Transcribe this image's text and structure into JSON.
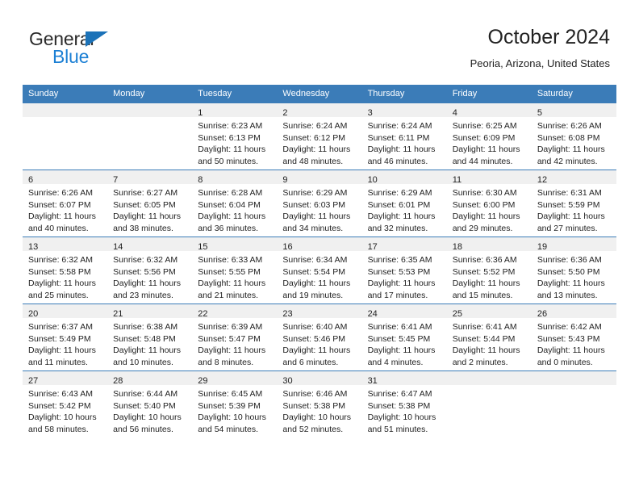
{
  "brand": {
    "name_top": "General",
    "name_bottom": "Blue",
    "accent_dark": "#1b72b8",
    "accent_light": "#1b7fd4"
  },
  "header": {
    "title": "October 2024",
    "subtitle": "Peoria, Arizona, United States"
  },
  "theme": {
    "header_bar": "#3b7cb8",
    "daynum_band": "#f0f0f0",
    "grid_line": "#3b7cb8",
    "text": "#1f1f1f"
  },
  "weekday_headers": [
    "Sunday",
    "Monday",
    "Tuesday",
    "Wednesday",
    "Thursday",
    "Friday",
    "Saturday"
  ],
  "labels": {
    "sunrise_prefix": "Sunrise:",
    "sunset_prefix": "Sunset:",
    "daylight_prefix": "Daylight:"
  },
  "weeks": [
    [
      {
        "day": "",
        "sunrise": "",
        "sunset": "",
        "daylight_line1": "",
        "daylight_line2": ""
      },
      {
        "day": "",
        "sunrise": "",
        "sunset": "",
        "daylight_line1": "",
        "daylight_line2": ""
      },
      {
        "day": "1",
        "sunrise": "Sunrise: 6:23 AM",
        "sunset": "Sunset: 6:13 PM",
        "daylight_line1": "Daylight: 11 hours",
        "daylight_line2": "and 50 minutes."
      },
      {
        "day": "2",
        "sunrise": "Sunrise: 6:24 AM",
        "sunset": "Sunset: 6:12 PM",
        "daylight_line1": "Daylight: 11 hours",
        "daylight_line2": "and 48 minutes."
      },
      {
        "day": "3",
        "sunrise": "Sunrise: 6:24 AM",
        "sunset": "Sunset: 6:11 PM",
        "daylight_line1": "Daylight: 11 hours",
        "daylight_line2": "and 46 minutes."
      },
      {
        "day": "4",
        "sunrise": "Sunrise: 6:25 AM",
        "sunset": "Sunset: 6:09 PM",
        "daylight_line1": "Daylight: 11 hours",
        "daylight_line2": "and 44 minutes."
      },
      {
        "day": "5",
        "sunrise": "Sunrise: 6:26 AM",
        "sunset": "Sunset: 6:08 PM",
        "daylight_line1": "Daylight: 11 hours",
        "daylight_line2": "and 42 minutes."
      }
    ],
    [
      {
        "day": "6",
        "sunrise": "Sunrise: 6:26 AM",
        "sunset": "Sunset: 6:07 PM",
        "daylight_line1": "Daylight: 11 hours",
        "daylight_line2": "and 40 minutes."
      },
      {
        "day": "7",
        "sunrise": "Sunrise: 6:27 AM",
        "sunset": "Sunset: 6:05 PM",
        "daylight_line1": "Daylight: 11 hours",
        "daylight_line2": "and 38 minutes."
      },
      {
        "day": "8",
        "sunrise": "Sunrise: 6:28 AM",
        "sunset": "Sunset: 6:04 PM",
        "daylight_line1": "Daylight: 11 hours",
        "daylight_line2": "and 36 minutes."
      },
      {
        "day": "9",
        "sunrise": "Sunrise: 6:29 AM",
        "sunset": "Sunset: 6:03 PM",
        "daylight_line1": "Daylight: 11 hours",
        "daylight_line2": "and 34 minutes."
      },
      {
        "day": "10",
        "sunrise": "Sunrise: 6:29 AM",
        "sunset": "Sunset: 6:01 PM",
        "daylight_line1": "Daylight: 11 hours",
        "daylight_line2": "and 32 minutes."
      },
      {
        "day": "11",
        "sunrise": "Sunrise: 6:30 AM",
        "sunset": "Sunset: 6:00 PM",
        "daylight_line1": "Daylight: 11 hours",
        "daylight_line2": "and 29 minutes."
      },
      {
        "day": "12",
        "sunrise": "Sunrise: 6:31 AM",
        "sunset": "Sunset: 5:59 PM",
        "daylight_line1": "Daylight: 11 hours",
        "daylight_line2": "and 27 minutes."
      }
    ],
    [
      {
        "day": "13",
        "sunrise": "Sunrise: 6:32 AM",
        "sunset": "Sunset: 5:58 PM",
        "daylight_line1": "Daylight: 11 hours",
        "daylight_line2": "and 25 minutes."
      },
      {
        "day": "14",
        "sunrise": "Sunrise: 6:32 AM",
        "sunset": "Sunset: 5:56 PM",
        "daylight_line1": "Daylight: 11 hours",
        "daylight_line2": "and 23 minutes."
      },
      {
        "day": "15",
        "sunrise": "Sunrise: 6:33 AM",
        "sunset": "Sunset: 5:55 PM",
        "daylight_line1": "Daylight: 11 hours",
        "daylight_line2": "and 21 minutes."
      },
      {
        "day": "16",
        "sunrise": "Sunrise: 6:34 AM",
        "sunset": "Sunset: 5:54 PM",
        "daylight_line1": "Daylight: 11 hours",
        "daylight_line2": "and 19 minutes."
      },
      {
        "day": "17",
        "sunrise": "Sunrise: 6:35 AM",
        "sunset": "Sunset: 5:53 PM",
        "daylight_line1": "Daylight: 11 hours",
        "daylight_line2": "and 17 minutes."
      },
      {
        "day": "18",
        "sunrise": "Sunrise: 6:36 AM",
        "sunset": "Sunset: 5:52 PM",
        "daylight_line1": "Daylight: 11 hours",
        "daylight_line2": "and 15 minutes."
      },
      {
        "day": "19",
        "sunrise": "Sunrise: 6:36 AM",
        "sunset": "Sunset: 5:50 PM",
        "daylight_line1": "Daylight: 11 hours",
        "daylight_line2": "and 13 minutes."
      }
    ],
    [
      {
        "day": "20",
        "sunrise": "Sunrise: 6:37 AM",
        "sunset": "Sunset: 5:49 PM",
        "daylight_line1": "Daylight: 11 hours",
        "daylight_line2": "and 11 minutes."
      },
      {
        "day": "21",
        "sunrise": "Sunrise: 6:38 AM",
        "sunset": "Sunset: 5:48 PM",
        "daylight_line1": "Daylight: 11 hours",
        "daylight_line2": "and 10 minutes."
      },
      {
        "day": "22",
        "sunrise": "Sunrise: 6:39 AM",
        "sunset": "Sunset: 5:47 PM",
        "daylight_line1": "Daylight: 11 hours",
        "daylight_line2": "and 8 minutes."
      },
      {
        "day": "23",
        "sunrise": "Sunrise: 6:40 AM",
        "sunset": "Sunset: 5:46 PM",
        "daylight_line1": "Daylight: 11 hours",
        "daylight_line2": "and 6 minutes."
      },
      {
        "day": "24",
        "sunrise": "Sunrise: 6:41 AM",
        "sunset": "Sunset: 5:45 PM",
        "daylight_line1": "Daylight: 11 hours",
        "daylight_line2": "and 4 minutes."
      },
      {
        "day": "25",
        "sunrise": "Sunrise: 6:41 AM",
        "sunset": "Sunset: 5:44 PM",
        "daylight_line1": "Daylight: 11 hours",
        "daylight_line2": "and 2 minutes."
      },
      {
        "day": "26",
        "sunrise": "Sunrise: 6:42 AM",
        "sunset": "Sunset: 5:43 PM",
        "daylight_line1": "Daylight: 11 hours",
        "daylight_line2": "and 0 minutes."
      }
    ],
    [
      {
        "day": "27",
        "sunrise": "Sunrise: 6:43 AM",
        "sunset": "Sunset: 5:42 PM",
        "daylight_line1": "Daylight: 10 hours",
        "daylight_line2": "and 58 minutes."
      },
      {
        "day": "28",
        "sunrise": "Sunrise: 6:44 AM",
        "sunset": "Sunset: 5:40 PM",
        "daylight_line1": "Daylight: 10 hours",
        "daylight_line2": "and 56 minutes."
      },
      {
        "day": "29",
        "sunrise": "Sunrise: 6:45 AM",
        "sunset": "Sunset: 5:39 PM",
        "daylight_line1": "Daylight: 10 hours",
        "daylight_line2": "and 54 minutes."
      },
      {
        "day": "30",
        "sunrise": "Sunrise: 6:46 AM",
        "sunset": "Sunset: 5:38 PM",
        "daylight_line1": "Daylight: 10 hours",
        "daylight_line2": "and 52 minutes."
      },
      {
        "day": "31",
        "sunrise": "Sunrise: 6:47 AM",
        "sunset": "Sunset: 5:38 PM",
        "daylight_line1": "Daylight: 10 hours",
        "daylight_line2": "and 51 minutes."
      },
      {
        "day": "",
        "sunrise": "",
        "sunset": "",
        "daylight_line1": "",
        "daylight_line2": ""
      },
      {
        "day": "",
        "sunrise": "",
        "sunset": "",
        "daylight_line1": "",
        "daylight_line2": ""
      }
    ]
  ]
}
